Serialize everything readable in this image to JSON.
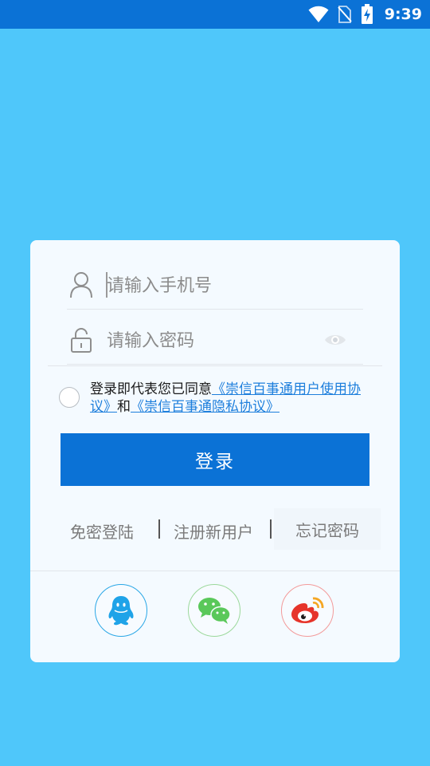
{
  "status_bar": {
    "time": "9:39",
    "icons": [
      "wifi-icon",
      "no-sim-icon",
      "battery-charging-icon"
    ]
  },
  "login": {
    "phone_placeholder": "请输入手机号",
    "password_placeholder": "请输入密码",
    "agreement_prefix": "登录即代表您已同意",
    "user_agreement": "《崇信百事通用户使用协议》",
    "agreement_and": "和",
    "privacy_agreement": "《崇信百事通隐私协议》",
    "login_label": "登录",
    "links": {
      "passwordless": "免密登陆",
      "register": "注册新用户",
      "forgot": "忘记密码"
    },
    "social_icons": [
      "qq-icon",
      "wechat-icon",
      "weibo-icon"
    ]
  },
  "colors": {
    "background": "#4FC7FA",
    "status_bar": "#0B72D6",
    "primary": "#0B72D6",
    "link": "#1E7FDC",
    "card": "#F4FAFF"
  }
}
